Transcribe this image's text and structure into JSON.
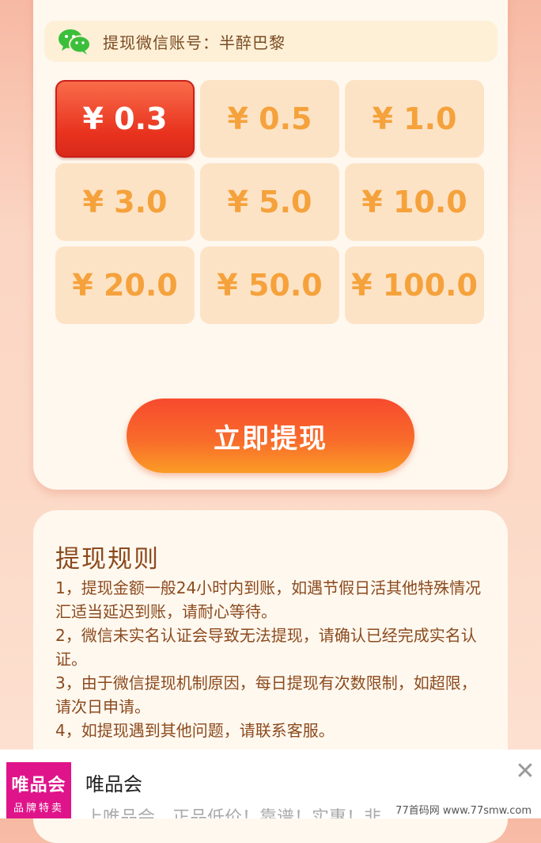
{
  "account": {
    "label": "提现微信账号：半醉巴黎",
    "icon": "wechat-icon",
    "icon_color": "#3bbf3b"
  },
  "amounts": {
    "items": [
      "¥ 0.3",
      "¥ 0.5",
      "¥ 1.0",
      "¥ 3.0",
      "¥ 5.0",
      "¥ 10.0",
      "¥ 20.0",
      "¥ 50.0",
      "¥ 100.0"
    ],
    "selected": "¥ 0.3"
  },
  "withdraw_button": {
    "label": "立即提现"
  },
  "rules": {
    "title": "提现规则",
    "items": [
      "1，提现金额一般24小时内到账，如遇节假日活其他特殊情况汇适当延迟到账，请耐心等待。",
      " 2，微信未实名认证会导致无法提现，请确认已经完成实名认证。",
      " 3，由于微信提现机制原因，每日提现有次数限制，如超限，请次日申请。",
      " 4，如提现遇到其他问题，请联系客服。"
    ]
  },
  "ad": {
    "logo_line1": "唯品会",
    "logo_line2": "品牌特卖",
    "title": "唯品会",
    "desc": "上唯品会，正品低价！靠谱！实惠！非",
    "close_icon": "close-icon",
    "brand_color": "#e0148a"
  },
  "watermark": "77首码网 www.77smw.com"
}
